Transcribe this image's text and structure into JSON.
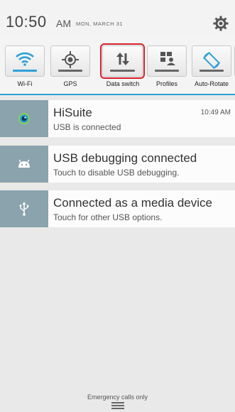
{
  "status": {
    "time": "10:50",
    "ampm": "AM",
    "date": "MON, MARCH 31"
  },
  "quick_settings": [
    {
      "label": "Wi-Fi",
      "icon": "wifi-icon",
      "active": true
    },
    {
      "label": "GPS",
      "icon": "gps-icon",
      "active": false
    },
    {
      "label": "Data switch",
      "icon": "data-switch-icon",
      "active": false,
      "selected": true
    },
    {
      "label": "Profiles",
      "icon": "profiles-icon",
      "active": false
    },
    {
      "label": "Auto-Rotate",
      "icon": "auto-rotate-icon",
      "active": false
    }
  ],
  "notifications": [
    {
      "title": "HiSuite",
      "subtitle": "USB is connected",
      "time": "10:49 AM",
      "icon": "hisuite-icon"
    },
    {
      "title": "USB debugging connected",
      "subtitle": "Touch to disable USB debugging.",
      "icon": "android-icon"
    },
    {
      "title": "Connected as a media device",
      "subtitle": "Touch for other USB options.",
      "icon": "usb-icon"
    }
  ],
  "footer": {
    "emergency_text": "Emergency calls only"
  },
  "colors": {
    "accent": "#2ea0d6",
    "icon_box": "#8aa3ad",
    "highlight": "#d6202a"
  }
}
